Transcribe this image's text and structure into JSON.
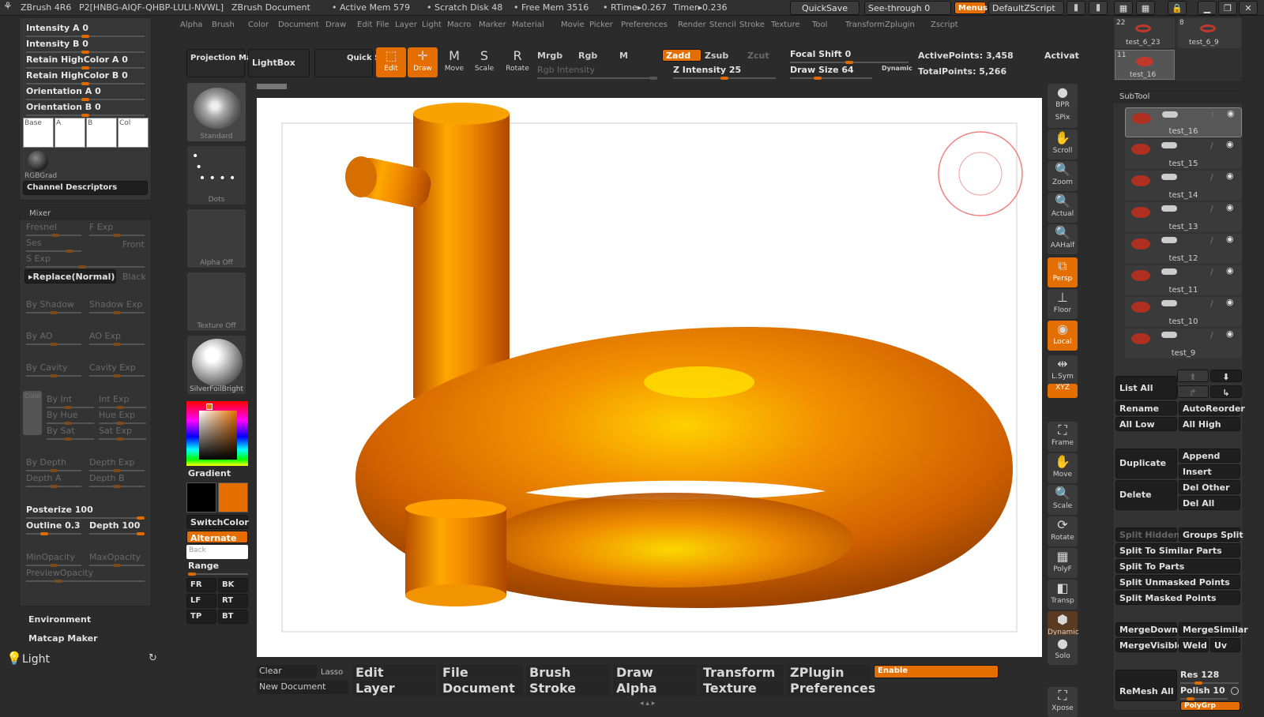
{
  "title": {
    "app": "ZBrush 4R6",
    "serial": "P2[HNBG-AIQF-QHBP-LULI-NVWL]",
    "doc": "ZBrush Document",
    "active_mem": "• Active Mem 579",
    "scratch": "• Scratch Disk 48",
    "free_mem": "• Free Mem 3516",
    "rtime": "• RTime▸0.267",
    "timer": "Timer▸0.236",
    "quicksave": "QuickSave",
    "see_through": "See-through  0",
    "menus": "Menus",
    "default_script": "DefaultZScript"
  },
  "menubar": [
    "Alpha",
    "Brush",
    "Color",
    "Document",
    "Draw",
    "Edit",
    "File",
    "Layer",
    "Light",
    "Macro",
    "Marker",
    "Material",
    "Movie",
    "Picker",
    "Preferences",
    "Render",
    "Stencil",
    "Stroke",
    "Texture",
    "Tool",
    "Transform",
    "Zplugin",
    "Zscript"
  ],
  "left_panel": {
    "intensity_a": "Intensity A 0",
    "intensity_b": "Intensity B 0",
    "retain_a": "Retain HighColor A 0",
    "retain_b": "Retain HighColor B 0",
    "orient_a": "Orientation A 0",
    "orient_b": "Orientation B 0",
    "swatches": [
      "Base",
      "A",
      "B",
      "Col"
    ],
    "rgbgrad": "RGBGrad",
    "channel_desc": "Channel Descriptors",
    "mixer": "Mixer",
    "fresnel": "Fresnel",
    "f_exp": "F Exp",
    "ses": "Ses",
    "front": "Front",
    "s_exp": "S Exp",
    "replace": "▸Replace(Normal)",
    "black": "Black",
    "by_shadow": "By Shadow",
    "shadow_exp": "Shadow Exp",
    "by_ao": "By AO",
    "ao_exp": "AO Exp",
    "by_cavity": "By Cavity",
    "cavity_exp": "Cavity Exp",
    "color": "Color",
    "by_int": "By Int",
    "int_exp": "Int Exp",
    "by_hue": "By Hue",
    "hue_exp": "Hue Exp",
    "by_sat": "By Sat",
    "sat_exp": "Sat Exp",
    "by_depth": "By Depth",
    "depth_exp": "Depth Exp",
    "depth_a": "Depth A",
    "depth_b": "Depth B",
    "posterize": "Posterize 100",
    "outline": "Outline 0.3",
    "depth": "Depth 100",
    "min_opacity": "MinOpacity",
    "max_opacity": "MaxOpacity",
    "preview_opacity": "PreviewOpacity",
    "environment": "Environment",
    "matcap_maker": "Matcap Maker",
    "light": "Light"
  },
  "tray": {
    "brush": "Standard",
    "stroke": "Dots",
    "alpha": "Alpha  Off",
    "texture": "Texture  Off",
    "material": "SilverFoilBright",
    "gradient": "Gradient",
    "switch_color": "SwitchColor",
    "alternate": "Alternate",
    "back": "Back",
    "range": "Range",
    "views": [
      "FR",
      "BK",
      "LF",
      "RT",
      "TP",
      "BT"
    ]
  },
  "toolbar": {
    "projection_master": "Projection Master",
    "lightbox": "LightBox",
    "quick_sketch": "Quick Sketch",
    "edit": "Edit",
    "draw": "Draw",
    "move": "Move",
    "scale": "Scale",
    "rotate": "Rotate",
    "mrgb": "Mrgb",
    "rgb": "Rgb",
    "m": "M",
    "rgb_intensity": "Rgb  Intensity",
    "zadd": "Zadd",
    "zsub": "Zsub",
    "zcut": "Zcut",
    "z_intensity": "Z Intensity 25",
    "focal_shift": "Focal Shift 0",
    "draw_size": "Draw Size 64",
    "dynamic": "Dynamic",
    "active_points": "ActivePoints: 3,458",
    "total_points": "TotalPoints: 5,266",
    "activate": "Activat"
  },
  "right_shelf": [
    "BPR",
    "SPix",
    "Scroll",
    "Zoom",
    "Actual",
    "AAHalf",
    "Persp",
    "Floor",
    "Local",
    "L.Sym",
    "XYZ",
    "Frame",
    "Move",
    "Scale",
    "Rotate",
    "PolyF",
    "Transp",
    "Dynamic",
    "Solo",
    "Xpose"
  ],
  "tool_thumbs": [
    {
      "num": "22",
      "name": "test_6_23"
    },
    {
      "num": "8",
      "name": "test_6_9"
    },
    {
      "num": "11",
      "name": "test_16"
    }
  ],
  "subtool": {
    "header": "SubTool",
    "items": [
      "test_16",
      "test_15",
      "test_14",
      "test_13",
      "test_12",
      "test_11",
      "test_10",
      "test_9"
    ],
    "list_all": "List  All",
    "rename": "Rename",
    "autoreorder": "AutoReorder",
    "all_low": "All Low",
    "all_high": "All High",
    "duplicate": "Duplicate",
    "append": "Append",
    "insert": "Insert",
    "delete": "Delete",
    "del_other": "Del Other",
    "del_all": "Del All",
    "split_hidden": "Split  Hidden",
    "groups_split": "Groups Split",
    "split_similar": "Split To Similar Parts",
    "split_parts": "Split To Parts",
    "split_unmasked": "Split Unmasked Points",
    "split_masked": "Split Masked Points",
    "merge_down": "MergeDown",
    "merge_similar": "MergeSimilar",
    "merge_visible": "MergeVisible",
    "weld": "Weld",
    "uv": "Uv",
    "remesh_all": "ReMesh  All",
    "res": "Res 128",
    "polish": "Polish 10",
    "polygrp": "PolyGrp"
  },
  "bottom": {
    "clear": "Clear",
    "lasso": "Lasso",
    "new_document": "New Document",
    "menus": [
      "Edit",
      "File",
      "Brush",
      "Draw",
      "Transform",
      "ZPlugin",
      "Layer",
      "Document",
      "Stroke",
      "Alpha",
      "Texture",
      "Preferences"
    ],
    "enable": "Enable"
  },
  "colors": {
    "accent": "#e46f00",
    "bg": "#2b2b2b",
    "model": "#e97f00"
  }
}
